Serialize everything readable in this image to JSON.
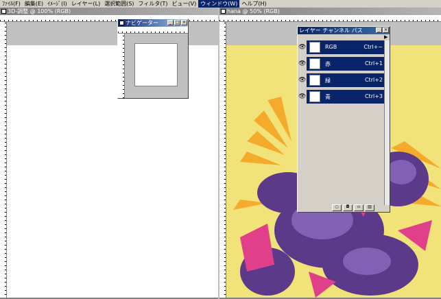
{
  "menu": {
    "items": [
      "ﾌｧｲﾙ(F)",
      "編集(E)",
      "ｲﾒｰｼﾞ(I)",
      "レイヤー(L)",
      "選択範囲(S)",
      "フィルタ(T)",
      "ビュー(V)",
      "ウィンドウ(W)",
      "ヘルプ(H)"
    ],
    "active_index": 7
  },
  "doc_left": {
    "title": "3D-調整 @ 100% (RGB)"
  },
  "navigator": {
    "title": "ナビゲーター"
  },
  "doc_right": {
    "title": "hana @ 50% (RGB)"
  },
  "layers": {
    "title": "レイヤー  チャンネル  パス",
    "rows": [
      {
        "name": "RGB",
        "shortcut": "Ctrl+~"
      },
      {
        "name": "赤",
        "shortcut": "Ctrl+1"
      },
      {
        "name": "緑",
        "shortcut": "Ctrl+2"
      },
      {
        "name": "青",
        "shortcut": "Ctrl+3"
      }
    ]
  },
  "colors": {
    "accent": "#0a246a",
    "panel": "#d4d0c8",
    "fabric": "#f2e27a"
  }
}
